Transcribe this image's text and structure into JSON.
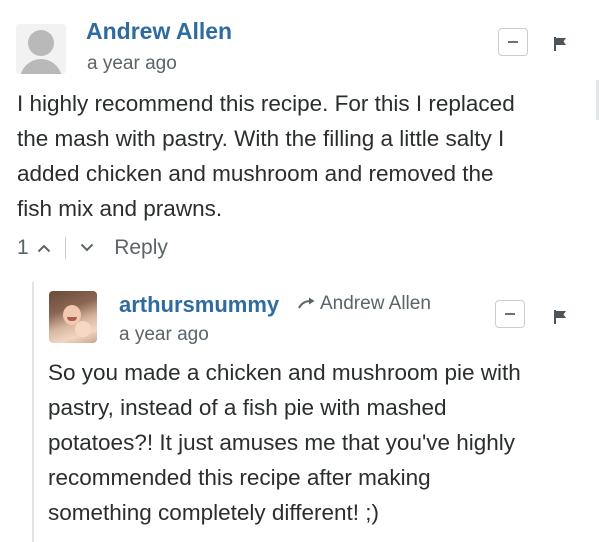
{
  "comments": [
    {
      "author": "Andrew Allen",
      "timestamp": "a year ago",
      "body_lines": [
        "I highly recommend this recipe. For this I replaced",
        "the mash with pastry. With the filling a little salty I",
        "added chicken and mushroom and removed the",
        "fish mix and prawns."
      ],
      "votes": "1",
      "reply_label": "Reply",
      "collapse_label": "−"
    },
    {
      "author": "arthursmummy",
      "in_reply_to": "Andrew Allen",
      "timestamp": "a year ago",
      "body_lines": [
        "So you made a chicken and mushroom pie with",
        "pastry, instead of a fish pie with mashed",
        "potatoes?! It just amuses me that you've highly",
        "recommended this recipe after making",
        "something completely different! ;)"
      ],
      "collapse_label": "−"
    }
  ],
  "icons": {
    "reply_arrow": "reply-arrow-icon",
    "flag": "flag-icon",
    "upvote": "upvote-chevron-icon",
    "downvote": "downvote-chevron-icon"
  },
  "colors": {
    "author": "#2e6b9f",
    "meta": "#5b6469",
    "text": "#2a2e2e",
    "border": "#c9cdd0"
  }
}
